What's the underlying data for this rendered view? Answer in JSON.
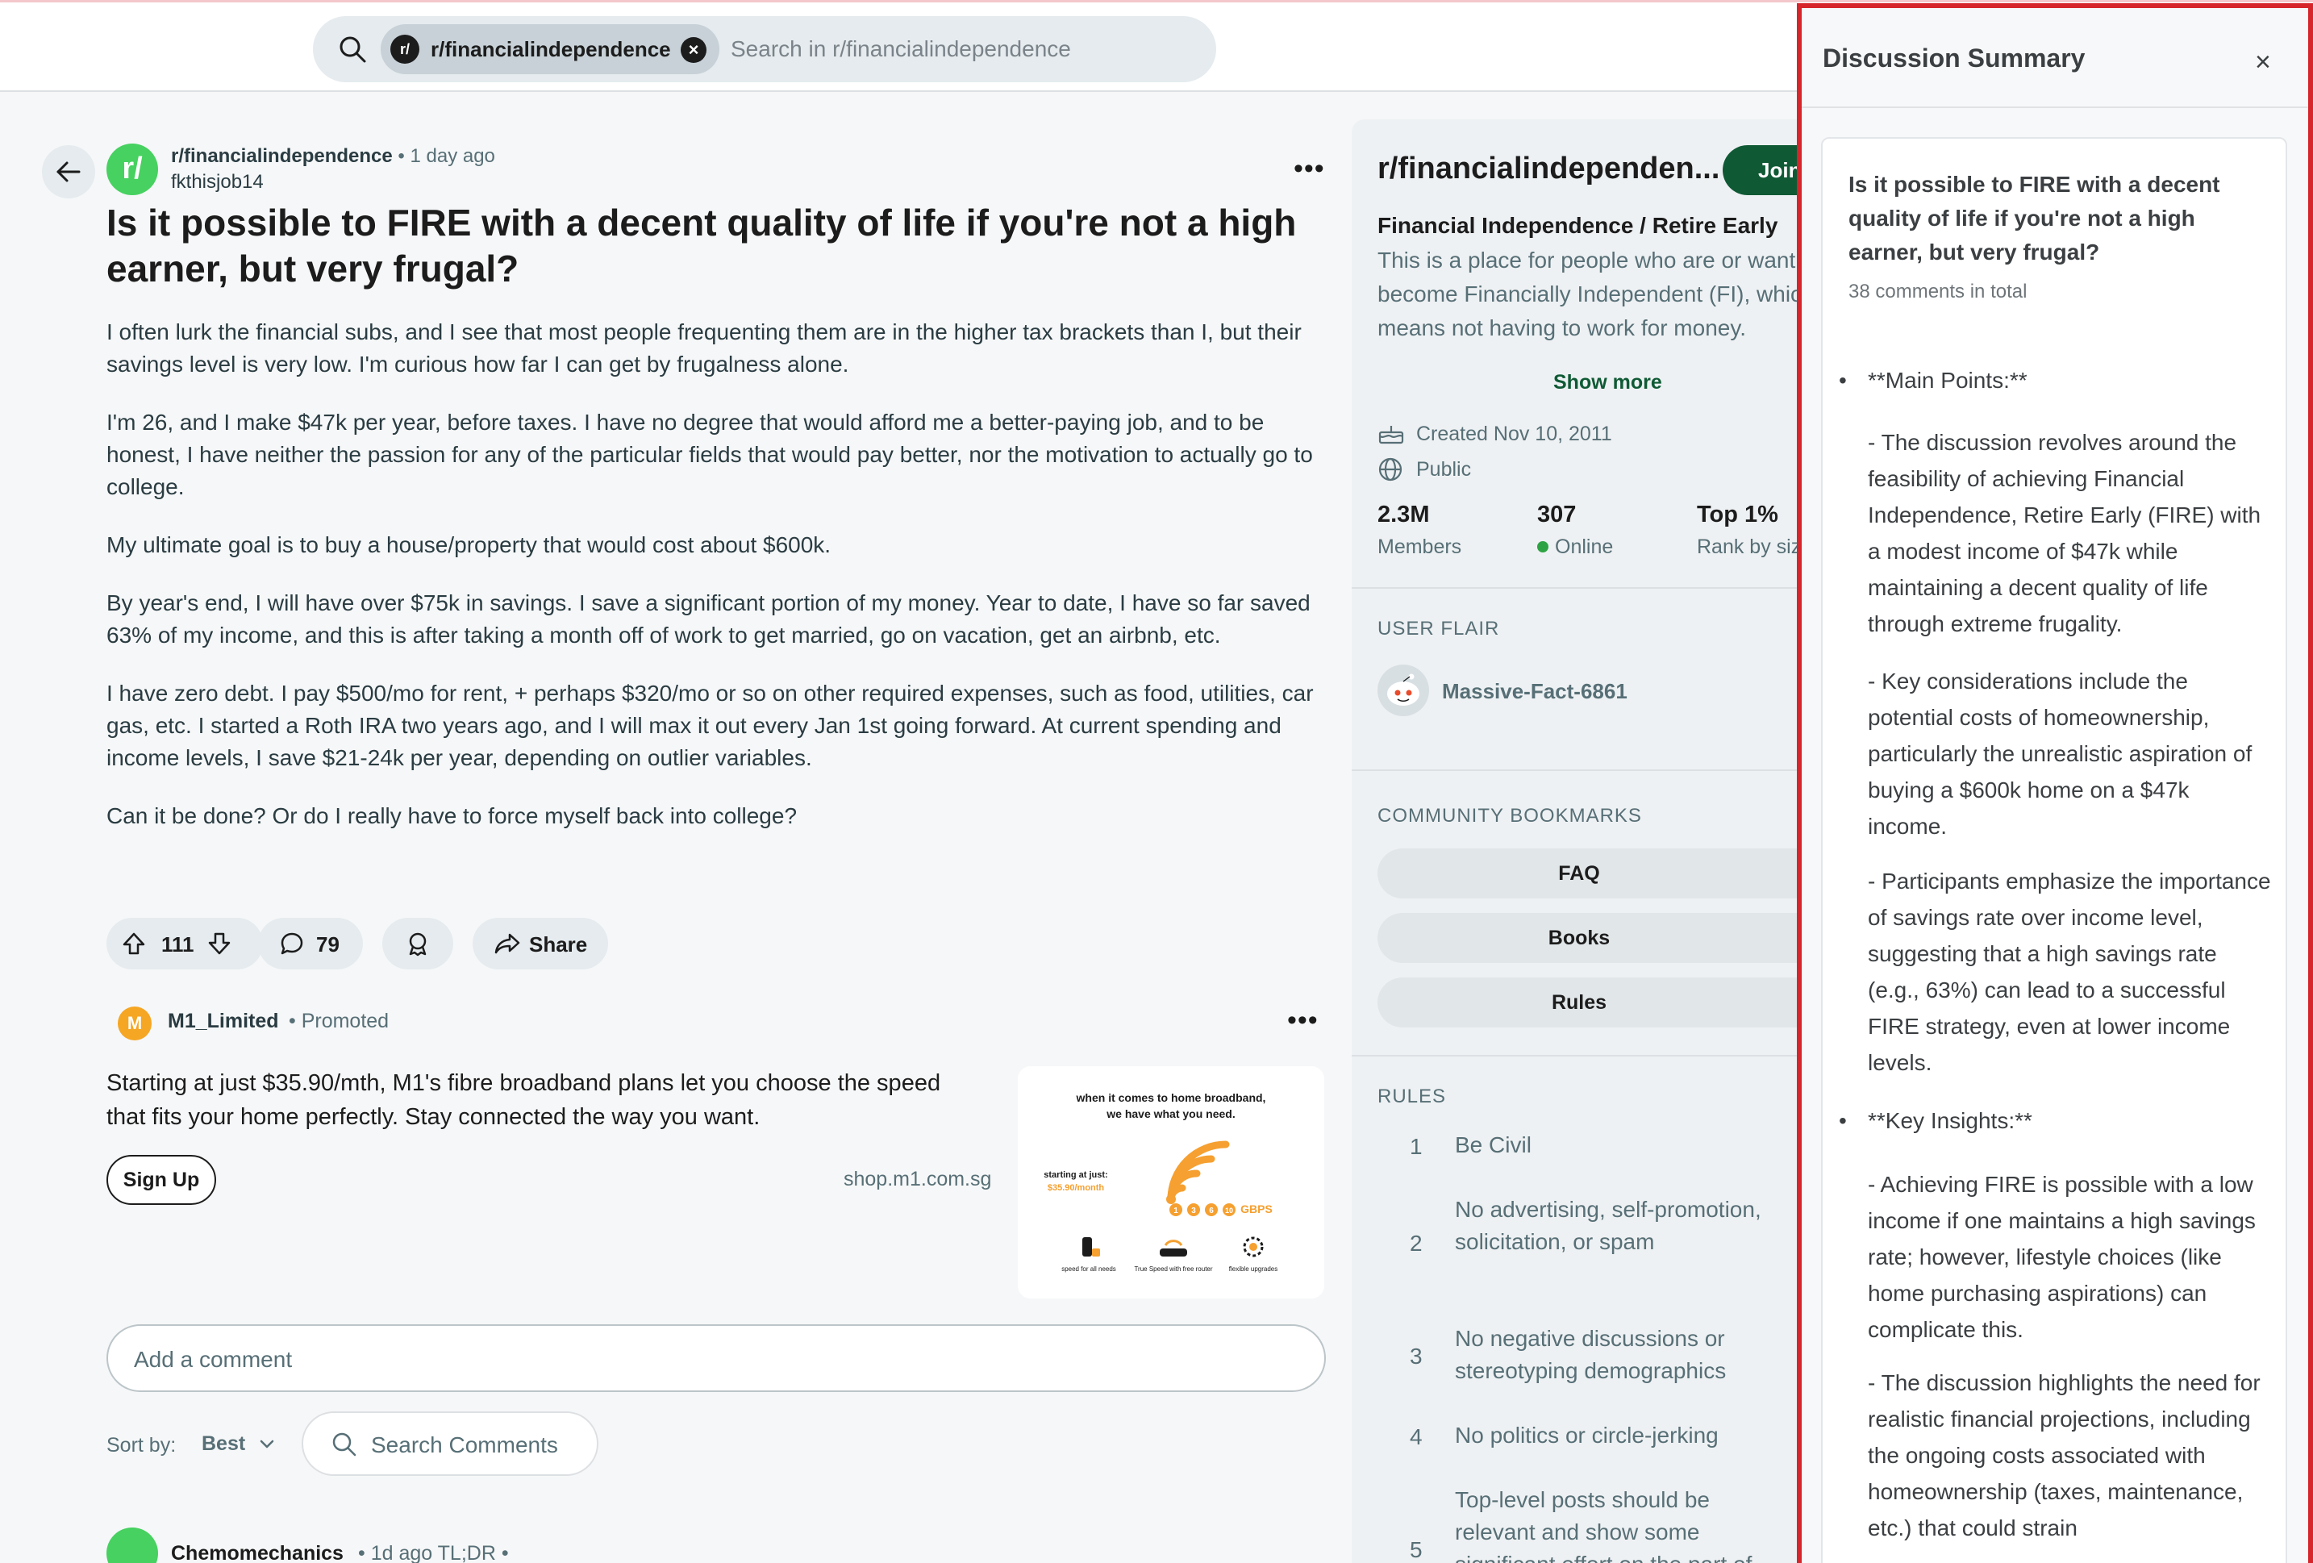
{
  "search": {
    "chip_label": "r/financialindependence",
    "chip_avatar": "r/",
    "placeholder": "Search in r/financialindependence"
  },
  "post": {
    "avatar": "r/",
    "subreddit": "r/financialindependence",
    "separator": "•",
    "time": "1 day ago",
    "author": "fkthisjob14",
    "more": "•••",
    "title": "Is it possible to FIRE with a decent quality of life if you're not a high earner, but very frugal?",
    "body": [
      "I often lurk the financial subs, and I see that most people frequenting them are in the higher tax brackets than I, but their savings level is very low. I'm curious how far I can get by frugalness alone.",
      "I'm 26, and I make $47k per year, before taxes. I have no degree that would afford me a better-paying job, and to be honest, I have neither the passion for any of the particular fields that would pay better, nor the motivation to actually go to college.",
      "My ultimate goal is to buy a house/property that would cost about $600k.",
      "By year's end, I will have over $75k in savings. I save a significant portion of my money. Year to date, I have so far saved 63% of my income, and this is after taking a month off of work to get married, go on vacation, get an airbnb, etc.",
      "I have zero debt. I pay $500/mo for rent, + perhaps $320/mo or so on other required expenses, such as food, utilities, car gas, etc. I started a Roth IRA two years ago, and I will max it out every Jan 1st going forward. At current spending and income levels, I save $21-24k per year, depending on outlier variables.",
      "Can it be done? Or do I really have to force myself back into college?"
    ],
    "votes": "111",
    "comments": "79",
    "share_label": "Share"
  },
  "promo": {
    "avatar": "M",
    "name": "M1_Limited",
    "tag": "• Promoted",
    "more": "•••",
    "text": "Starting at just $35.90/mth, M1's fibre broadband plans let you choose the speed that fits your home perfectly. Stay connected the way you want.",
    "cta": "Sign Up",
    "domain": "shop.m1.com.sg",
    "ad": {
      "headline_1": "when it comes to home broadband,",
      "headline_2": "we have what you need.",
      "price_label": "starting at just:",
      "price": "$35.90/month",
      "speeds": [
        "1",
        "3",
        "6",
        "10"
      ],
      "unit": "GBPS",
      "features": [
        "speed for all needs",
        "True Speed with free router",
        "flexible upgrades"
      ]
    }
  },
  "comments": {
    "add_placeholder": "Add a comment",
    "sort_label": "Sort by:",
    "sort_value": "Best",
    "search_placeholder": "Search Comments",
    "first_author": "Chemomechanics",
    "first_meta": "• 1d ago  TL;DR •"
  },
  "sidebar": {
    "title": "r/financialindependen...",
    "join_label": "Join",
    "subtitle": "Financial Independence / Retire Early",
    "description": "This is a place for people who are or want to become Financially Independent (FI), which means not having to work for money.",
    "show_more": "Show more",
    "created": "Created Nov 10, 2011",
    "visibility": "Public",
    "stats": [
      {
        "value": "2.3M",
        "label": "Members"
      },
      {
        "value": "307",
        "label": "Online"
      },
      {
        "value": "Top 1%",
        "label": "Rank by size"
      }
    ],
    "user_flair_heading": "USER FLAIR",
    "flair_user": "Massive-Fact-6861",
    "bookmarks_heading": "COMMUNITY BOOKMARKS",
    "bookmarks": [
      "FAQ",
      "Books",
      "Rules"
    ],
    "rules_heading": "RULES",
    "rules": [
      {
        "num": "1",
        "text": "Be Civil"
      },
      {
        "num": "2",
        "text": "No advertising, self-promotion, solicitation, or spam"
      },
      {
        "num": "3",
        "text": "No negative discussions or stereotyping demographics"
      },
      {
        "num": "4",
        "text": "No politics or circle-jerking"
      },
      {
        "num": "5",
        "text": "Top-level posts should be relevant and show some significant effort on the part of"
      }
    ]
  },
  "summary": {
    "title": "Discussion Summary",
    "close": "×",
    "card_title": "Is it possible to FIRE with a decent quality of life if you're not a high earner, but very frugal?",
    "count": "38 comments in total",
    "main_points_heading": "**Main Points:**",
    "main_points": [
      "- The discussion revolves around the feasibility of achieving Financial Independence, Retire Early (FIRE) with a modest income of $47k while maintaining a decent quality of life through extreme frugality.",
      "- Key considerations include the potential costs of homeownership, particularly the unrealistic aspiration of buying a $600k home on a $47k income.",
      "- Participants emphasize the importance of savings rate over income level, suggesting that a high savings rate (e.g., 63%) can lead to a successful FIRE strategy, even at lower income levels."
    ],
    "insights_heading": "**Key Insights:**",
    "insights": [
      "- Achieving FIRE is possible with a low income if one maintains a high savings rate; however, lifestyle choices (like home purchasing aspirations) can complicate this.",
      "- The discussion highlights the need for realistic financial projections, including the ongoing costs associated with homeownership (taxes, maintenance, etc.) that could strain"
    ]
  },
  "colors": {
    "accent_green": "#0f5a35",
    "summary_border": "#d6262b",
    "subreddit_avatar": "#46d160"
  }
}
